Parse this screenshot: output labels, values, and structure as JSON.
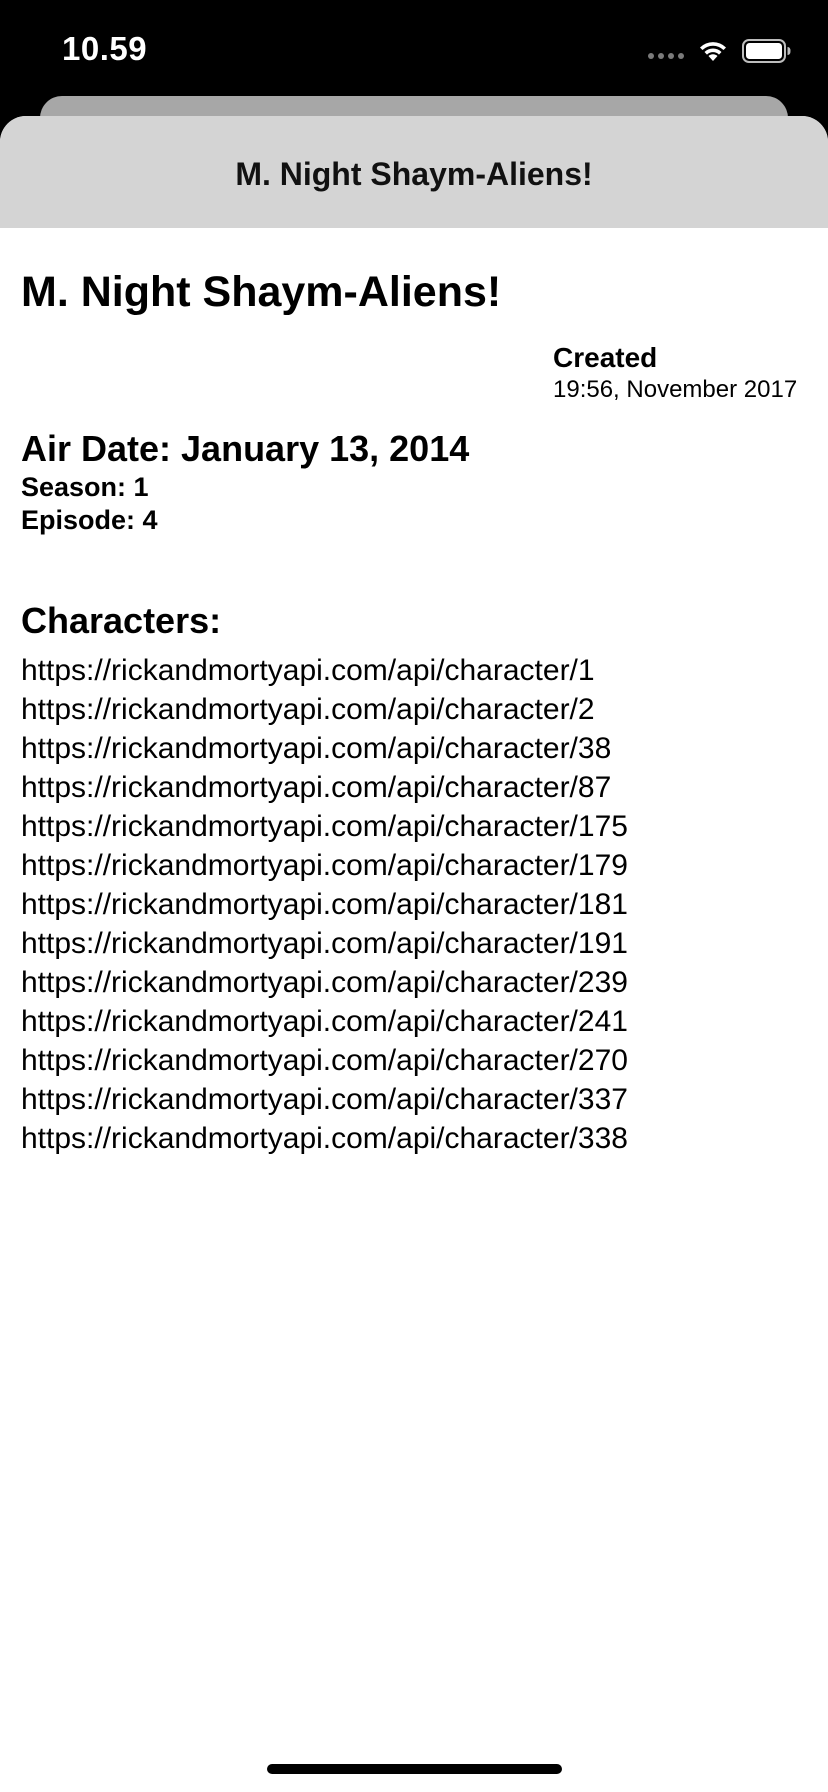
{
  "status_bar": {
    "time": "10.59",
    "icons": [
      "cellular-dots-icon",
      "wifi-icon",
      "battery-icon"
    ]
  },
  "nav": {
    "title": "M. Night Shaym-Aliens!"
  },
  "episode": {
    "name": "M. Night Shaym-Aliens!",
    "created_label": "Created",
    "created_value": "19:56, November 2017",
    "air_date": "Air Date: January 13, 2014",
    "season": "Season: 1",
    "episode": "Episode: 4"
  },
  "characters": {
    "heading": "Characters:",
    "urls": [
      "https://rickandmortyapi.com/api/character/1",
      "https://rickandmortyapi.com/api/character/2",
      "https://rickandmortyapi.com/api/character/38",
      "https://rickandmortyapi.com/api/character/87",
      "https://rickandmortyapi.com/api/character/175",
      "https://rickandmortyapi.com/api/character/179",
      "https://rickandmortyapi.com/api/character/181",
      "https://rickandmortyapi.com/api/character/191",
      "https://rickandmortyapi.com/api/character/239",
      "https://rickandmortyapi.com/api/character/241",
      "https://rickandmortyapi.com/api/character/270",
      "https://rickandmortyapi.com/api/character/337",
      "https://rickandmortyapi.com/api/character/338"
    ]
  },
  "colors": {
    "status_bar_bg": "#000000",
    "nav_bar_bg": "#d4d4d4",
    "sheet_bg": "#ffffff",
    "text": "#000000"
  }
}
